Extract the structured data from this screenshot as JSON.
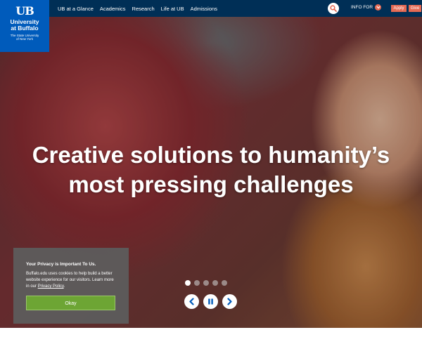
{
  "logo": {
    "mark": "UB",
    "name_line1": "University",
    "name_line2": "at Buffalo",
    "sub_line1": "The State University",
    "sub_line2": "of New York"
  },
  "nav": {
    "items": [
      {
        "label": "UB at a Glance"
      },
      {
        "label": "Academics"
      },
      {
        "label": "Research"
      },
      {
        "label": "Life at UB"
      },
      {
        "label": "Admissions"
      }
    ]
  },
  "utility": {
    "info_for_label": "INFO FOR",
    "apply_label": "Apply",
    "give_label": "Give"
  },
  "hero": {
    "headline_line1": "Creative solutions to humanity’s",
    "headline_line2": "most pressing challenges",
    "slide_count": 5,
    "active_slide": 1
  },
  "privacy": {
    "title": "Your Privacy is Important To Us.",
    "body": "Buffalo.edu uses cookies to help build a better website experience for our visitors. Learn more in our",
    "link_label": "Privacy Policy",
    "link_suffix": ".",
    "accept_label": "Okay"
  },
  "colors": {
    "topbar": "#002f56",
    "logo_bg": "#005bbb",
    "accent_red": "#e56a54",
    "okay_green": "#6da534"
  }
}
